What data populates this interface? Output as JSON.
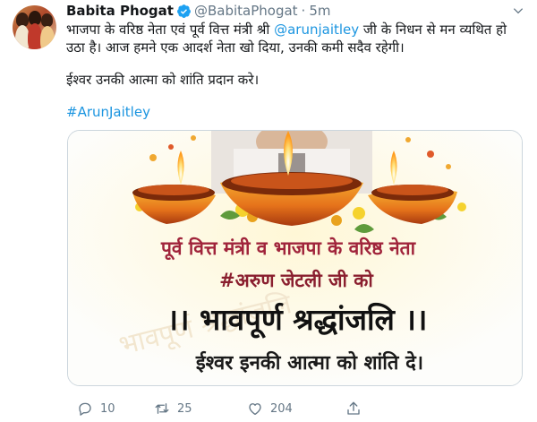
{
  "tweet": {
    "author": {
      "name": "Babita Phogat",
      "handle": "@BabitaPhogat",
      "separator": "·",
      "time": "5m",
      "verified": true
    },
    "text": {
      "line1_pre": "भाजपा के वरिष्ठ नेता एवं पूर्व वित्त मंत्री श्री ",
      "mention": "@arunjaitley",
      "line1_post": " जी के निधन से मन व्यथित हो",
      "line2": "उठा है। आज हमने एक आदर्श नेता खो दिया, उनकी कमी सदैव रहेगी।",
      "line3": "ईश्वर उनकी आत्मा को शांति प्रदान करे।",
      "hashtag": "#ArunJaitley"
    },
    "image": {
      "line1": "पूर्व वित्त मंत्री व भाजपा के वरिष्ठ नेता",
      "line2": "#अरुण जेटली जी को",
      "line3": "।। भावपूर्ण श्रद्धांजलि ।।",
      "line4": "ईश्वर इनकी आत्मा को शांति दे।",
      "watermark": "भावपूर्ण श्रद्धांजलि"
    },
    "actions": {
      "reply_count": "10",
      "retweet_count": "25",
      "like_count": "204"
    }
  },
  "colors": {
    "link": "#1b95e0",
    "verified": "#1da1f2",
    "muted": "#657786",
    "text": "#14171a"
  },
  "icons": {
    "verified": "verified-badge-icon",
    "caret": "chevron-down-icon",
    "reply": "reply-icon",
    "retweet": "retweet-icon",
    "like": "heart-icon",
    "share": "share-icon"
  }
}
